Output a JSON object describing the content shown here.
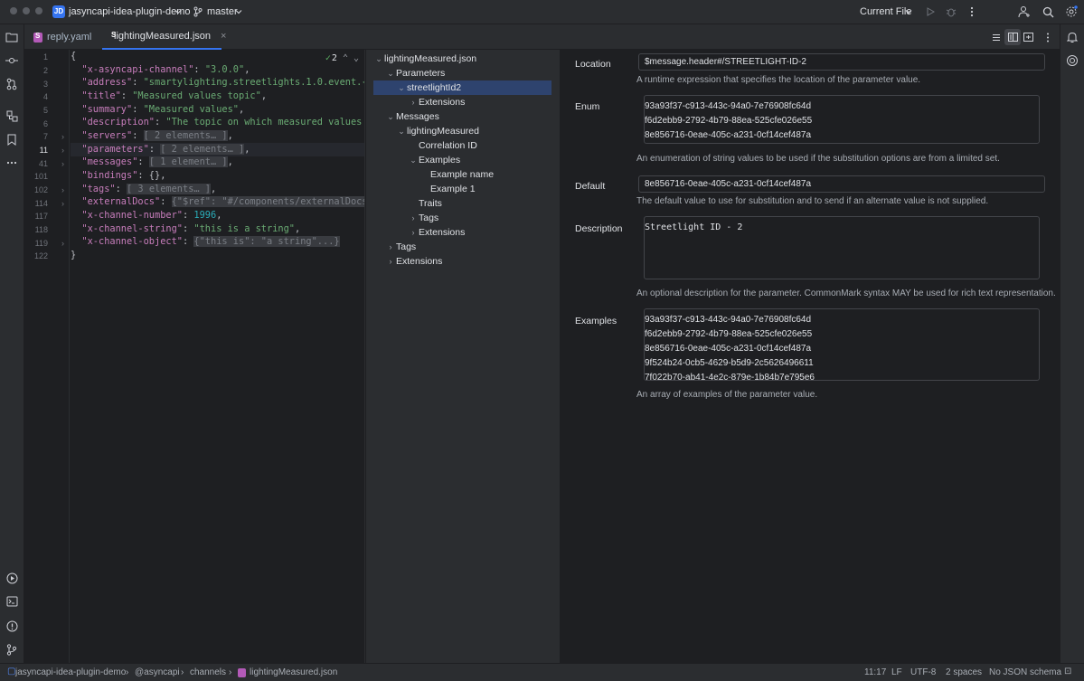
{
  "titlebar": {
    "project_badge": "JD",
    "project_name": "jasyncapi-idea-plugin-demo",
    "branch": "master",
    "run_config": "Current File"
  },
  "tabs": [
    {
      "label": "reply.yaml",
      "active": false
    },
    {
      "label": "lightingMeasured.json",
      "active": true,
      "close": "×"
    }
  ],
  "editor": {
    "inspection_count": "2",
    "line_numbers": [
      "1",
      "2",
      "3",
      "4",
      "5",
      "6",
      "7",
      "11",
      "41",
      "101",
      "102",
      "114",
      "117",
      "118",
      "119",
      "122"
    ],
    "current_line": "11"
  },
  "tree": {
    "nodes": [
      {
        "label": "lightingMeasured.json",
        "depth": 0,
        "arrow": "open"
      },
      {
        "label": "Parameters",
        "depth": 1,
        "arrow": "open"
      },
      {
        "label": "streetlightId2",
        "depth": 2,
        "arrow": "open",
        "selected": true
      },
      {
        "label": "Extensions",
        "depth": 3,
        "arrow": "closed"
      },
      {
        "label": "Messages",
        "depth": 1,
        "arrow": "open"
      },
      {
        "label": "lightingMeasured",
        "depth": 2,
        "arrow": "open"
      },
      {
        "label": "Correlation ID",
        "depth": 3,
        "arrow": "none"
      },
      {
        "label": "Examples",
        "depth": 3,
        "arrow": "open"
      },
      {
        "label": "Example name",
        "depth": 4,
        "arrow": "none"
      },
      {
        "label": "Example 1",
        "depth": 4,
        "arrow": "none"
      },
      {
        "label": "Traits",
        "depth": 3,
        "arrow": "none"
      },
      {
        "label": "Tags",
        "depth": 3,
        "arrow": "closed"
      },
      {
        "label": "Extensions",
        "depth": 3,
        "arrow": "closed"
      },
      {
        "label": "Tags",
        "depth": 1,
        "arrow": "closed"
      },
      {
        "label": "Extensions",
        "depth": 1,
        "arrow": "closed"
      }
    ]
  },
  "props": {
    "location": {
      "label": "Location",
      "value": "$message.header#/STREETLIGHT-ID-2",
      "help": "A runtime expression that specifies the location of the parameter value."
    },
    "enum": {
      "label": "Enum",
      "values": [
        "93a93f37-c913-443c-94a0-7e76908fc64d",
        "f6d2ebb9-2792-4b79-88ea-525cfe026e55",
        "8e856716-0eae-405c-a231-0cf14cef487a"
      ],
      "help": "An enumeration of string values to be used if the substitution options are from a limited set."
    },
    "default": {
      "label": "Default",
      "value": "8e856716-0eae-405c-a231-0cf14cef487a",
      "help": "The default value to use for substitution and to send if an alternate value is not supplied."
    },
    "description": {
      "label": "Description",
      "value": "Streetlight ID - 2",
      "help": "An optional description for the parameter. CommonMark syntax MAY be used for rich text representation."
    },
    "examples": {
      "label": "Examples",
      "values": [
        "93a93f37-c913-443c-94a0-7e76908fc64d",
        "f6d2ebb9-2792-4b79-88ea-525cfe026e55",
        "8e856716-0eae-405c-a231-0cf14cef487a",
        "9f524b24-0cb5-4629-b5d9-2c5626496611",
        "7f022b70-ab41-4e2c-879e-1b84b7e795e6"
      ],
      "help": "An array of examples of the parameter value."
    }
  },
  "statusbar": {
    "breadcrumbs": [
      "jasyncapi-idea-plugin-demo",
      "@asyncapi",
      "channels",
      "lightingMeasured.json"
    ],
    "position": "11:17",
    "line_ending": "LF",
    "encoding": "UTF-8",
    "indent": "2 spaces",
    "schema": "No JSON schema"
  }
}
